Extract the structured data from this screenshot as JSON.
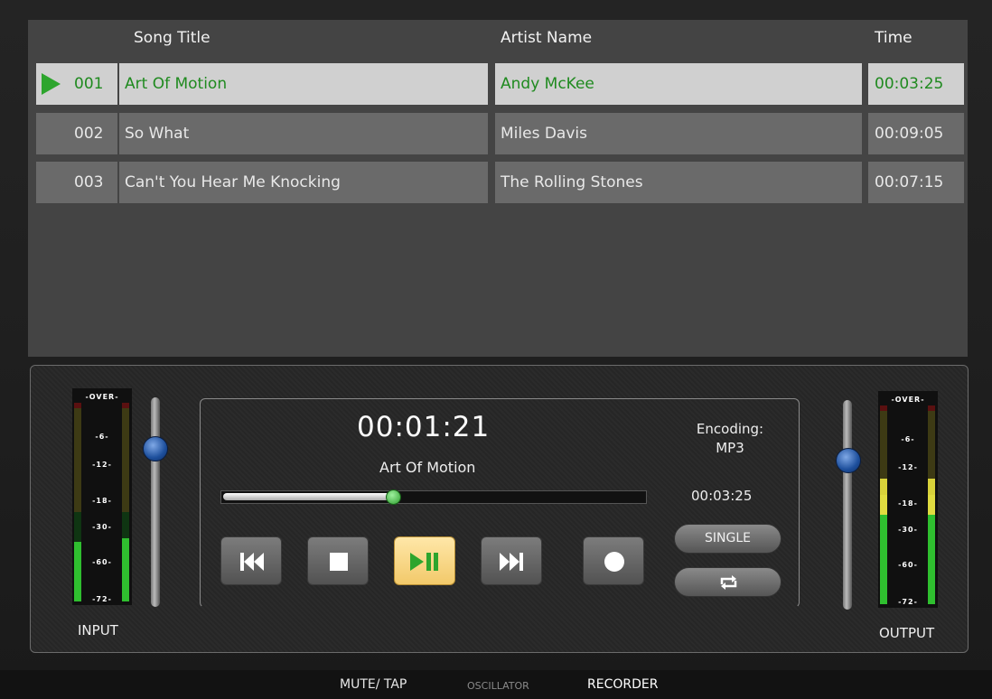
{
  "playlist": {
    "headers": {
      "song_title": "Song Title",
      "artist_name": "Artist Name",
      "time": "Time"
    },
    "rows": [
      {
        "num": "001",
        "title": "Art Of Motion",
        "artist": "Andy McKee",
        "time": "00:03:25",
        "playing": true
      },
      {
        "num": "002",
        "title": "So What",
        "artist": "Miles Davis",
        "time": "00:09:05",
        "playing": false
      },
      {
        "num": "003",
        "title": "Can't You Hear Me Knocking",
        "artist": "The Rolling Stones",
        "time": "00:07:15",
        "playing": false
      }
    ]
  },
  "input_meter": {
    "label": "INPUT",
    "scale": [
      "-OVER-",
      "-6-",
      "-12-",
      "-18-",
      "-30-",
      "-60-",
      "-72-"
    ],
    "level_left": 0.3,
    "level_right": 0.32
  },
  "output_meter": {
    "label": "OUTPUT",
    "scale": [
      "-OVER-",
      "-6-",
      "-12-",
      "-18-",
      "-30-",
      "-60-",
      "-72-"
    ],
    "level_left": 0.63,
    "level_right": 0.63
  },
  "transport": {
    "elapsed": "00:01:21",
    "song": "Art Of Motion",
    "encoding_label": "Encoding:",
    "encoding_value": "MP3",
    "total_time": "00:03:25",
    "progress": 0.4,
    "single_label": "SINGLE",
    "repeat_icon": "repeat-icon",
    "buttons": [
      "previous-icon",
      "stop-icon",
      "play-pause-icon",
      "next-icon",
      "record-icon"
    ],
    "colors": {
      "accent_green": "#2da52d",
      "play_button": "#f2c96a",
      "fader_knob": "#1d4f9c"
    }
  },
  "nav": {
    "tabs": [
      {
        "label": "MUTE/ TAP",
        "active": false
      },
      {
        "label": "OSCILLATOR",
        "active": false
      },
      {
        "label": "RECORDER",
        "active": true
      }
    ]
  }
}
